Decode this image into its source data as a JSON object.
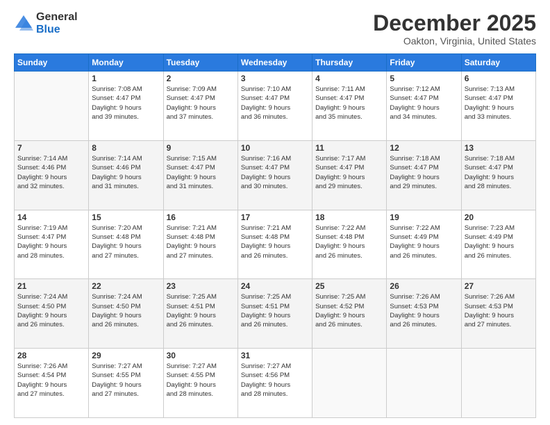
{
  "logo": {
    "general": "General",
    "blue": "Blue"
  },
  "header": {
    "title": "December 2025",
    "subtitle": "Oakton, Virginia, United States"
  },
  "days_of_week": [
    "Sunday",
    "Monday",
    "Tuesday",
    "Wednesday",
    "Thursday",
    "Friday",
    "Saturday"
  ],
  "weeks": [
    [
      {
        "day": "",
        "info": ""
      },
      {
        "day": "1",
        "info": "Sunrise: 7:08 AM\nSunset: 4:47 PM\nDaylight: 9 hours\nand 39 minutes."
      },
      {
        "day": "2",
        "info": "Sunrise: 7:09 AM\nSunset: 4:47 PM\nDaylight: 9 hours\nand 37 minutes."
      },
      {
        "day": "3",
        "info": "Sunrise: 7:10 AM\nSunset: 4:47 PM\nDaylight: 9 hours\nand 36 minutes."
      },
      {
        "day": "4",
        "info": "Sunrise: 7:11 AM\nSunset: 4:47 PM\nDaylight: 9 hours\nand 35 minutes."
      },
      {
        "day": "5",
        "info": "Sunrise: 7:12 AM\nSunset: 4:47 PM\nDaylight: 9 hours\nand 34 minutes."
      },
      {
        "day": "6",
        "info": "Sunrise: 7:13 AM\nSunset: 4:47 PM\nDaylight: 9 hours\nand 33 minutes."
      }
    ],
    [
      {
        "day": "7",
        "info": "Sunrise: 7:14 AM\nSunset: 4:46 PM\nDaylight: 9 hours\nand 32 minutes."
      },
      {
        "day": "8",
        "info": "Sunrise: 7:14 AM\nSunset: 4:46 PM\nDaylight: 9 hours\nand 31 minutes."
      },
      {
        "day": "9",
        "info": "Sunrise: 7:15 AM\nSunset: 4:47 PM\nDaylight: 9 hours\nand 31 minutes."
      },
      {
        "day": "10",
        "info": "Sunrise: 7:16 AM\nSunset: 4:47 PM\nDaylight: 9 hours\nand 30 minutes."
      },
      {
        "day": "11",
        "info": "Sunrise: 7:17 AM\nSunset: 4:47 PM\nDaylight: 9 hours\nand 29 minutes."
      },
      {
        "day": "12",
        "info": "Sunrise: 7:18 AM\nSunset: 4:47 PM\nDaylight: 9 hours\nand 29 minutes."
      },
      {
        "day": "13",
        "info": "Sunrise: 7:18 AM\nSunset: 4:47 PM\nDaylight: 9 hours\nand 28 minutes."
      }
    ],
    [
      {
        "day": "14",
        "info": "Sunrise: 7:19 AM\nSunset: 4:47 PM\nDaylight: 9 hours\nand 28 minutes."
      },
      {
        "day": "15",
        "info": "Sunrise: 7:20 AM\nSunset: 4:48 PM\nDaylight: 9 hours\nand 27 minutes."
      },
      {
        "day": "16",
        "info": "Sunrise: 7:21 AM\nSunset: 4:48 PM\nDaylight: 9 hours\nand 27 minutes."
      },
      {
        "day": "17",
        "info": "Sunrise: 7:21 AM\nSunset: 4:48 PM\nDaylight: 9 hours\nand 26 minutes."
      },
      {
        "day": "18",
        "info": "Sunrise: 7:22 AM\nSunset: 4:48 PM\nDaylight: 9 hours\nand 26 minutes."
      },
      {
        "day": "19",
        "info": "Sunrise: 7:22 AM\nSunset: 4:49 PM\nDaylight: 9 hours\nand 26 minutes."
      },
      {
        "day": "20",
        "info": "Sunrise: 7:23 AM\nSunset: 4:49 PM\nDaylight: 9 hours\nand 26 minutes."
      }
    ],
    [
      {
        "day": "21",
        "info": "Sunrise: 7:24 AM\nSunset: 4:50 PM\nDaylight: 9 hours\nand 26 minutes."
      },
      {
        "day": "22",
        "info": "Sunrise: 7:24 AM\nSunset: 4:50 PM\nDaylight: 9 hours\nand 26 minutes."
      },
      {
        "day": "23",
        "info": "Sunrise: 7:25 AM\nSunset: 4:51 PM\nDaylight: 9 hours\nand 26 minutes."
      },
      {
        "day": "24",
        "info": "Sunrise: 7:25 AM\nSunset: 4:51 PM\nDaylight: 9 hours\nand 26 minutes."
      },
      {
        "day": "25",
        "info": "Sunrise: 7:25 AM\nSunset: 4:52 PM\nDaylight: 9 hours\nand 26 minutes."
      },
      {
        "day": "26",
        "info": "Sunrise: 7:26 AM\nSunset: 4:53 PM\nDaylight: 9 hours\nand 26 minutes."
      },
      {
        "day": "27",
        "info": "Sunrise: 7:26 AM\nSunset: 4:53 PM\nDaylight: 9 hours\nand 27 minutes."
      }
    ],
    [
      {
        "day": "28",
        "info": "Sunrise: 7:26 AM\nSunset: 4:54 PM\nDaylight: 9 hours\nand 27 minutes."
      },
      {
        "day": "29",
        "info": "Sunrise: 7:27 AM\nSunset: 4:55 PM\nDaylight: 9 hours\nand 27 minutes."
      },
      {
        "day": "30",
        "info": "Sunrise: 7:27 AM\nSunset: 4:55 PM\nDaylight: 9 hours\nand 28 minutes."
      },
      {
        "day": "31",
        "info": "Sunrise: 7:27 AM\nSunset: 4:56 PM\nDaylight: 9 hours\nand 28 minutes."
      },
      {
        "day": "",
        "info": ""
      },
      {
        "day": "",
        "info": ""
      },
      {
        "day": "",
        "info": ""
      }
    ]
  ]
}
